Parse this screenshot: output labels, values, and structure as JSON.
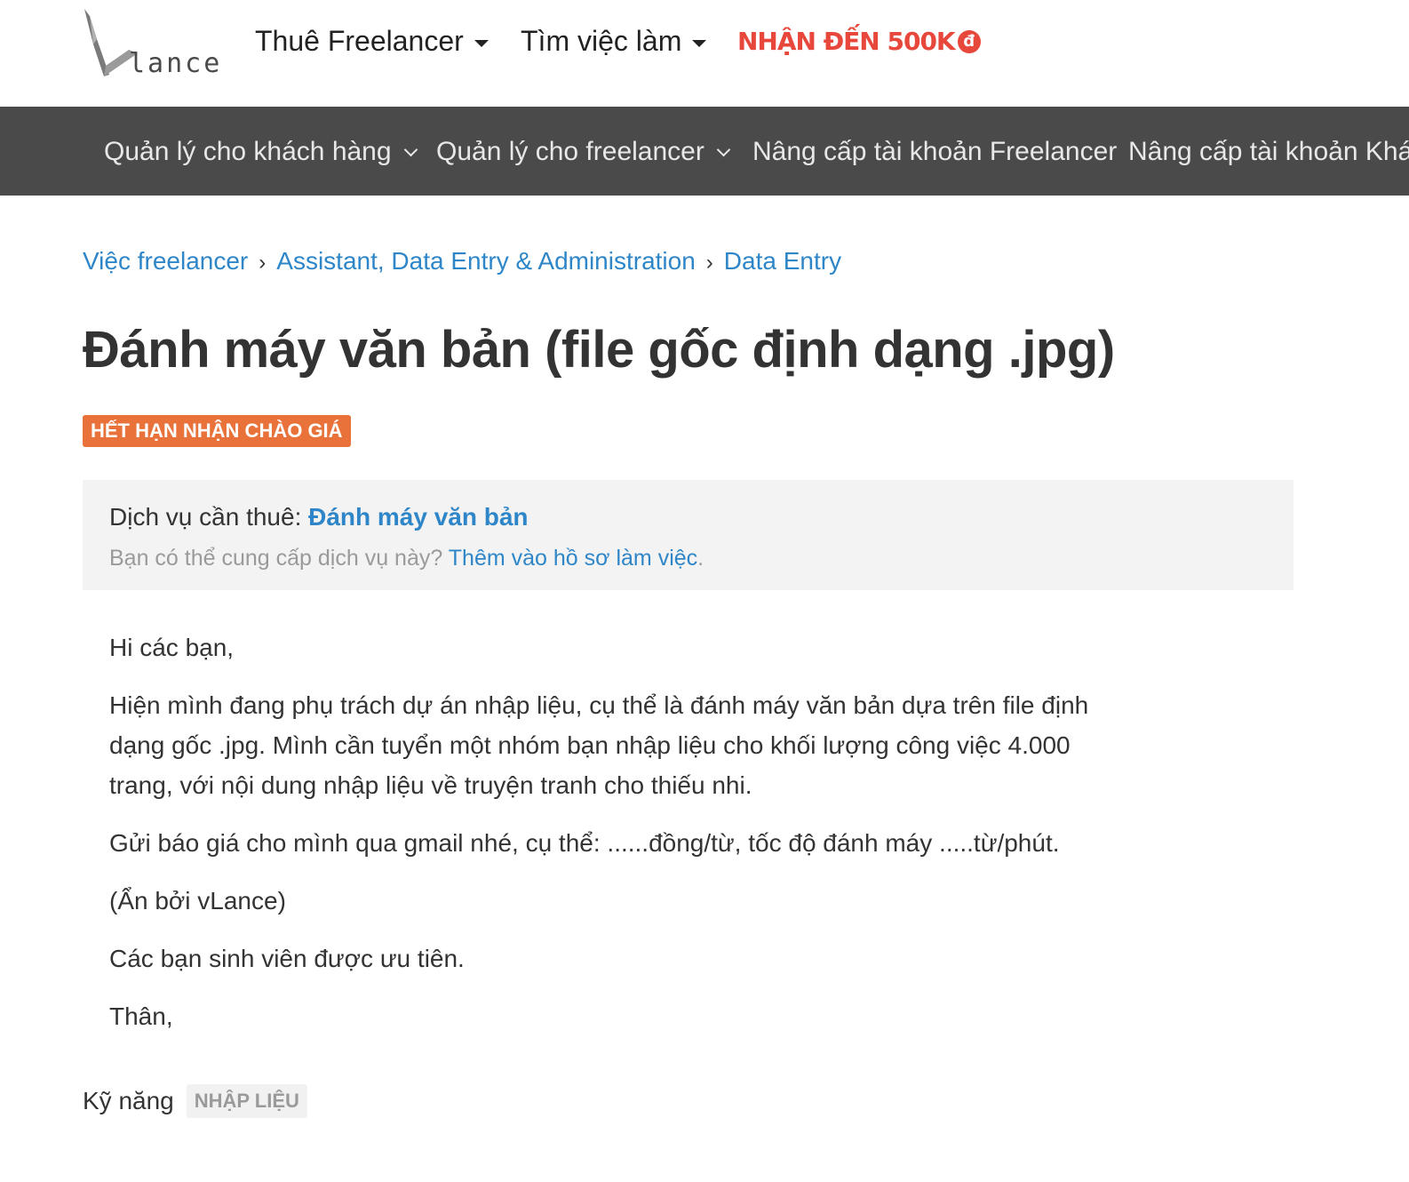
{
  "header": {
    "logo_text": "lance",
    "nav": [
      {
        "label": "Thuê Freelancer"
      },
      {
        "label": "Tìm việc làm"
      }
    ],
    "promo": {
      "label": "NHẬN ĐẾN 500K",
      "coin": "đ"
    }
  },
  "subnav": [
    {
      "label": "Quản lý cho khách hàng"
    },
    {
      "label": "Quản lý cho freelancer"
    },
    {
      "label": "Nâng cấp tài khoản Freelancer"
    },
    {
      "label": "Nâng cấp tài khoản Khách hàng"
    }
  ],
  "breadcrumb": [
    {
      "label": "Việc freelancer"
    },
    {
      "label": "Assistant, Data Entry & Administration"
    },
    {
      "label": "Data Entry"
    }
  ],
  "breadcrumb_sep": "›",
  "job": {
    "title": "Đánh máy văn bản (file gốc định dạng .jpg)",
    "status": "HẾT HẠN NHẬN CHÀO GIÁ",
    "service": {
      "prefix": "Dịch vụ cần thuê: ",
      "name": "Đánh máy văn bản",
      "hint": "Bạn có thể cung cấp dịch vụ này? ",
      "add_link": "Thêm vào hồ sơ làm việc",
      "period": "."
    },
    "description": [
      "Hi các bạn,",
      "Hiện mình đang phụ trách dự án nhập liệu, cụ thể là đánh máy văn bản dựa trên file định dạng gốc .jpg. Mình cần tuyển một nhóm bạn nhập liệu cho khối lượng công việc 4.000 trang, với nội dung nhập liệu về truyện tranh cho thiếu nhi.",
      "Gửi báo giá cho mình qua gmail nhé, cụ thể: ......đồng/từ, tốc độ đánh máy .....từ/phút.",
      "(Ẩn bởi vLance)",
      "Các bạn sinh viên được ưu tiên.",
      "Thân,"
    ],
    "skills_label": "Kỹ năng",
    "skills": [
      "NHẬP LIỆU"
    ]
  },
  "colors": {
    "link": "#2e86c8",
    "promo": "#e8473b",
    "badge": "#e8723a",
    "subnav_bg": "#4a4a4a",
    "service_bg": "#f3f3f3"
  }
}
